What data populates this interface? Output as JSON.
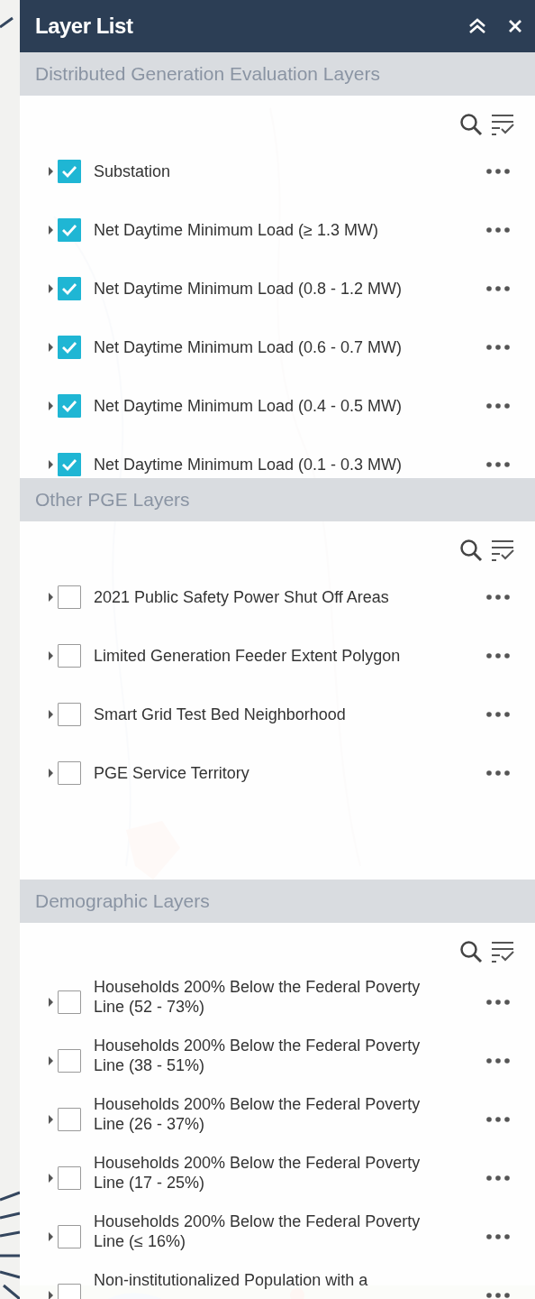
{
  "panel": {
    "title": "Layer List"
  },
  "sections": [
    {
      "title": "Distributed Generation Evaluation Layers",
      "layers": [
        {
          "name": "Substation",
          "checked": true
        },
        {
          "name": "Net Daytime Minimum Load (≥ 1.3 MW)",
          "checked": true
        },
        {
          "name": "Net Daytime Minimum Load (0.8 - 1.2 MW)",
          "checked": true
        },
        {
          "name": "Net Daytime Minimum Load (0.6 - 0.7 MW)",
          "checked": true
        },
        {
          "name": "Net Daytime Minimum Load (0.4 - 0.5 MW)",
          "checked": true
        },
        {
          "name": "Net Daytime Minimum Load (0.1 - 0.3 MW)",
          "checked": true
        }
      ]
    },
    {
      "title": "Other PGE Layers",
      "layers": [
        {
          "name": "2021 Public Safety Power Shut Off Areas",
          "checked": false
        },
        {
          "name": "Limited Generation Feeder Extent Polygon",
          "checked": false
        },
        {
          "name": "Smart Grid Test Bed Neighborhood",
          "checked": false
        },
        {
          "name": "PGE Service Territory",
          "checked": false
        }
      ]
    },
    {
      "title": "Demographic Layers",
      "layers": [
        {
          "name": "Households 200% Below the Federal Poverty Line (52 - 73%)",
          "checked": false
        },
        {
          "name": "Households 200% Below the Federal Poverty Line (38 - 51%)",
          "checked": false
        },
        {
          "name": "Households 200% Below the Federal Poverty Line (26 - 37%)",
          "checked": false
        },
        {
          "name": "Households 200% Below the Federal Poverty Line (17 - 25%)",
          "checked": false
        },
        {
          "name": "Households 200% Below the Federal Poverty Line (≤ 16%)",
          "checked": false
        },
        {
          "name": "Non-institutionalized Population with a",
          "checked": false
        }
      ]
    }
  ]
}
